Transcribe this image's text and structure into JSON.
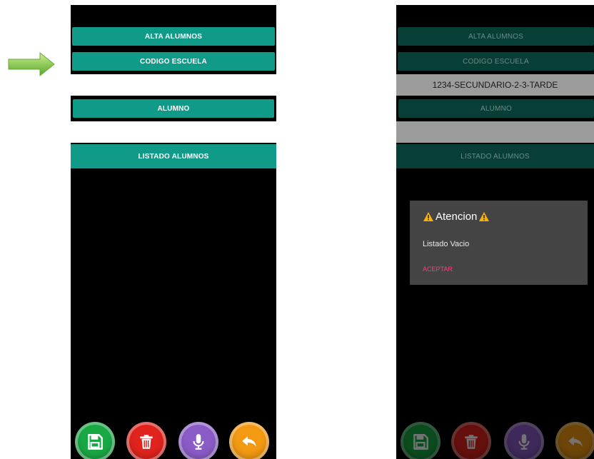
{
  "left_screen": {
    "buttons": {
      "alta": "ALTA ALUMNOS",
      "codigo": "CODIGO ESCUELA",
      "alumno": "ALUMNO",
      "listado": "LISTADO ALUMNOS"
    },
    "fields": {
      "codigo_value": "",
      "alumno_value": ""
    }
  },
  "right_screen": {
    "buttons": {
      "alta": "ALTA ALUMNOS",
      "codigo": "CODIGO ESCUELA",
      "alumno": "ALUMNO",
      "listado": "LISTADO ALUMNOS"
    },
    "fields": {
      "codigo_value": "1234-SECUNDARIO-2-3-TARDE",
      "alumno_value": ""
    },
    "dialog": {
      "title": "Atencion",
      "message": "Listado Vacio",
      "button": "ACEPTAR"
    }
  },
  "bottom_icons": [
    "save-icon",
    "trash-icon",
    "microphone-icon",
    "back-arrow-icon"
  ],
  "colors": {
    "teal": "#0f9b87",
    "save": "#1aa845",
    "delete": "#e0231d",
    "mic": "#8b5cc7",
    "back": "#f39a12",
    "dialog_accent": "#ff3d7f",
    "arrow": "#7dc63a"
  }
}
